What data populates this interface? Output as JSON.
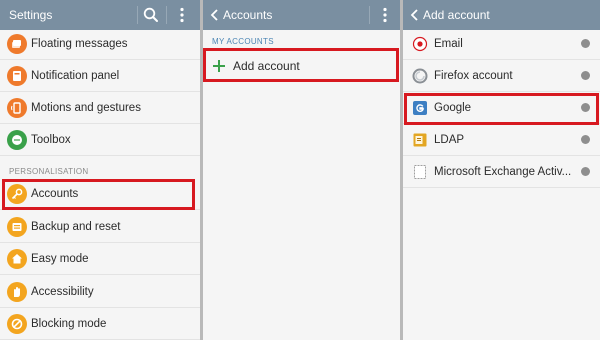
{
  "settings_panel": {
    "title": "Settings",
    "items_top": [
      {
        "label": "Floating messages",
        "icon": "floating-messages-icon",
        "color": "#ef7a2c"
      },
      {
        "label": "Notification panel",
        "icon": "notification-panel-icon",
        "color": "#ef7a2c"
      },
      {
        "label": "Motions and gestures",
        "icon": "motions-gestures-icon",
        "color": "#ef7a2c"
      },
      {
        "label": "Toolbox",
        "icon": "toolbox-icon",
        "color": "#3aa14a"
      }
    ],
    "section_header": "PERSONALISATION",
    "items_personal": [
      {
        "label": "Accounts",
        "icon": "key-icon",
        "color": "#f3a51f"
      },
      {
        "label": "Backup and reset",
        "icon": "backup-icon",
        "color": "#f3a51f"
      },
      {
        "label": "Easy mode",
        "icon": "home-icon",
        "color": "#f3a51f"
      },
      {
        "label": "Accessibility",
        "icon": "hand-icon",
        "color": "#f3a51f"
      },
      {
        "label": "Blocking mode",
        "icon": "blocking-icon",
        "color": "#f3a51f"
      }
    ]
  },
  "accounts_panel": {
    "title": "Accounts",
    "section_header": "MY ACCOUNTS",
    "add_account_label": "Add account"
  },
  "add_account_panel": {
    "title": "Add account",
    "items": [
      {
        "label": "Email",
        "icon": "email-icon"
      },
      {
        "label": "Firefox account",
        "icon": "firefox-icon"
      },
      {
        "label": "Google",
        "icon": "google-icon"
      },
      {
        "label": "LDAP",
        "icon": "ldap-icon"
      },
      {
        "label": "Microsoft Exchange Activ...",
        "icon": "exchange-icon"
      }
    ]
  },
  "colors": {
    "app_bar": "#7a8fa1",
    "highlight": "#d71920",
    "accent_green": "#3aa14a",
    "section_blue": "#4d86b4"
  }
}
